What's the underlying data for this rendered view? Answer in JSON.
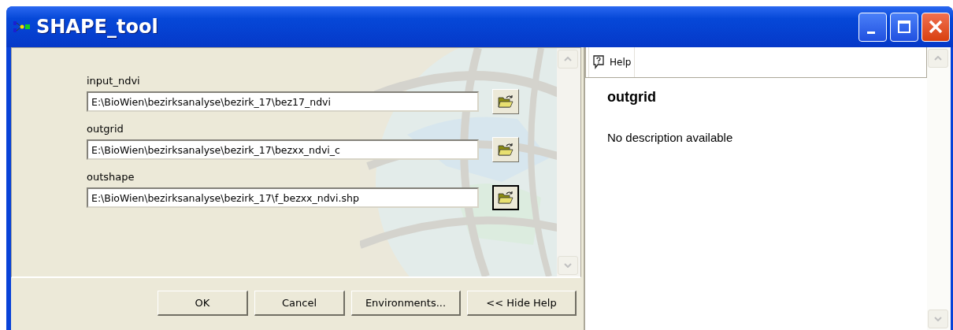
{
  "window": {
    "title": "SHAPE_tool"
  },
  "parameters": [
    {
      "label": "input_ndvi",
      "value": "E:\\BioWien\\bezirksanalyse\\bezirk_17\\bez17_ndvi",
      "focused": false
    },
    {
      "label": "outgrid",
      "value": "E:\\BioWien\\bezirksanalyse\\bezirk_17\\bezxx_ndvi_c",
      "focused": false
    },
    {
      "label": "outshape",
      "value": "E:\\BioWien\\bezirksanalyse\\bezirk_17\\f_bezxx_ndvi.shp",
      "focused": true
    }
  ],
  "buttons": [
    "OK",
    "Cancel",
    "Environments...",
    "<< Hide Help"
  ],
  "help_panel": {
    "toolbar_button": "Help",
    "heading": "outgrid",
    "description": "No description available"
  }
}
